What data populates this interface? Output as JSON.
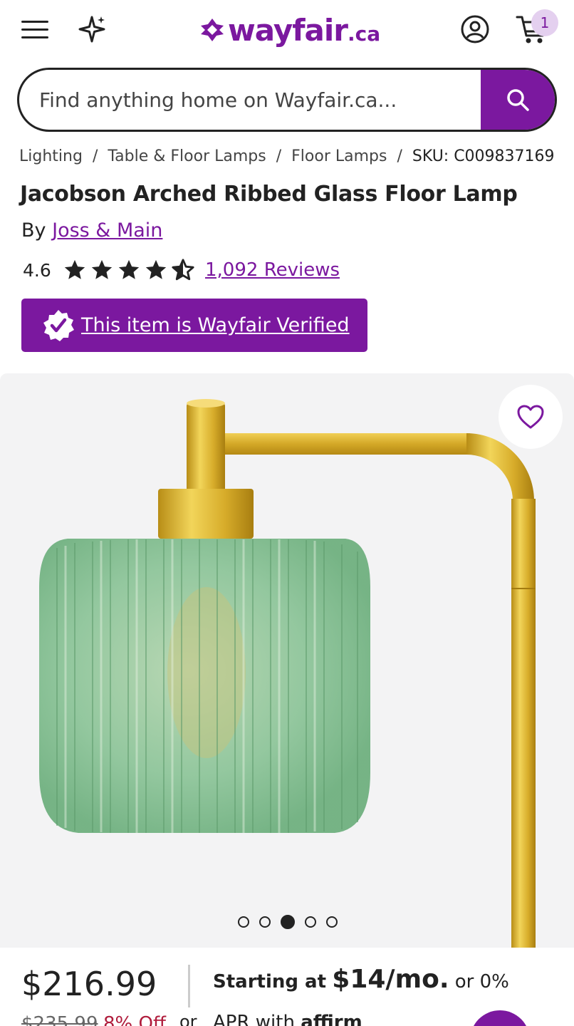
{
  "header": {
    "logo_text": "wayfair",
    "logo_tld": ".ca",
    "cart_count": "1",
    "icons": [
      "hamburger-menu-icon",
      "sparkle-icon",
      "account-icon",
      "cart-icon"
    ],
    "brand_color": "#7b189f"
  },
  "search": {
    "placeholder": "Find anything home on Wayfair.ca..."
  },
  "breadcrumb": {
    "items": [
      "Lighting",
      "Table & Floor Lamps",
      "Floor Lamps"
    ],
    "sku": "SKU: C009837169"
  },
  "product": {
    "title": "Jacobson Arched Ribbed Glass Floor Lamp",
    "by_prefix": "By",
    "brand": "Joss & Main",
    "rating": "4.6",
    "reviews": "1,092 Reviews",
    "verified_label": "This item is Wayfair Verified"
  },
  "gallery": {
    "image_count": 5,
    "active_index": 2
  },
  "pricing": {
    "price": "$216.99",
    "original_price": "$235.99",
    "discount": "8% Off",
    "financing_prefix": "Starting at",
    "financing_amount": "$14/mo.",
    "financing_suffix": "or 0%",
    "or_label": "or",
    "apr_text": "APR with",
    "affirm_label": "affirm"
  }
}
